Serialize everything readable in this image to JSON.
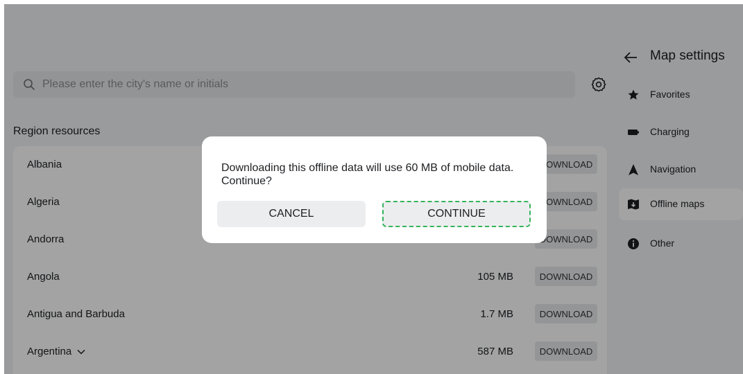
{
  "search": {
    "placeholder": "Please enter the city's name or initials"
  },
  "region": {
    "title": "Region resources",
    "download_label": "DOWNLOAD",
    "rows": [
      {
        "name": "Albania",
        "size": ""
      },
      {
        "name": "Algeria",
        "size": ""
      },
      {
        "name": "Andorra",
        "size": ""
      },
      {
        "name": "Angola",
        "size": "105 MB"
      },
      {
        "name": "Antigua and Barbuda",
        "size": "1.7 MB"
      },
      {
        "name": "Argentina",
        "size": "587 MB"
      }
    ]
  },
  "sidebar": {
    "title": "Map settings",
    "items": [
      {
        "label": "Favorites",
        "icon": "star-icon"
      },
      {
        "label": "Charging",
        "icon": "battery-icon"
      },
      {
        "label": "Navigation",
        "icon": "navigation-arrow-icon"
      },
      {
        "label": "Offline maps",
        "icon": "map-download-icon",
        "selected": true
      },
      {
        "label": "Other",
        "icon": "info-icon"
      }
    ]
  },
  "dialog": {
    "message": "Downloading this offline data will use 60 MB of mobile data. Continue?",
    "cancel_label": "CANCEL",
    "continue_label": "CONTINUE"
  },
  "colors": {
    "focus_outline": "#32b45a",
    "overlay": "#000000"
  }
}
